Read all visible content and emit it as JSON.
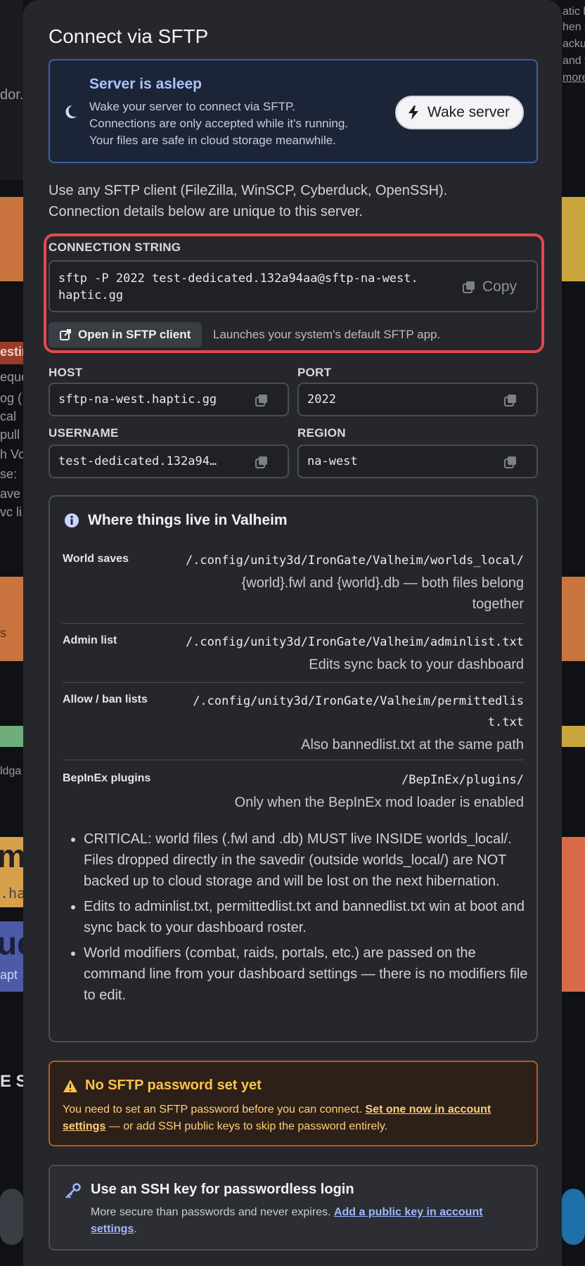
{
  "modal": {
    "title": "Connect via SFTP"
  },
  "asleep": {
    "heading": "Server is asleep",
    "lines": [
      "Wake your server to connect via SFTP.",
      "Connections are only accepted while it's running.",
      "Your files are safe in cloud storage meanwhile."
    ],
    "wake_label": "Wake server"
  },
  "intro": {
    "line1": "Use any SFTP client (FileZilla, WinSCP, Cyberduck, OpenSSH).",
    "line2": "Connection details below are unique to this server."
  },
  "connection": {
    "label": "CONNECTION STRING",
    "value": "sftp -P 2022 test-dedicated.132a94aa@sftp-na-west.haptic.gg",
    "copy_label": "Copy",
    "open_label": "Open in SFTP client",
    "open_note": "Launches your system's default SFTP app."
  },
  "fields": {
    "host": {
      "label": "HOST",
      "value": "sftp-na-west.haptic.gg"
    },
    "port": {
      "label": "PORT",
      "value": "2022"
    },
    "username": {
      "label": "USERNAME",
      "value": "test-dedicated.132a94…"
    },
    "region": {
      "label": "REGION",
      "value": "na-west"
    }
  },
  "where": {
    "heading": "Where things live in Valheim",
    "rows": [
      {
        "key": "World saves",
        "path": "/.config/unity3d/IronGate/Valheim/worlds_local/",
        "note_lines": [
          "{world}.fwl and {world}.db — both files belong",
          "together"
        ]
      },
      {
        "key": "Admin list",
        "path": "/.config/unity3d/IronGate/Valheim/adminlist.txt",
        "note_lines": [
          "Edits sync back to your dashboard"
        ]
      },
      {
        "key": "Allow / ban lists",
        "path_lines": [
          "/.config/unity3d/IronGate/Valheim/permittedlis",
          "t.txt"
        ],
        "note_lines": [
          "Also bannedlist.txt at the same path"
        ]
      },
      {
        "key": "BepInEx plugins",
        "path": "/BepInEx/plugins/",
        "note_lines": [
          "Only when the BepInEx mod loader is enabled"
        ]
      }
    ],
    "bullets": [
      "CRITICAL: world files (.fwl and .db) MUST live INSIDE worlds_local/. Files dropped directly in the savedir (outside worlds_local/) are NOT backed up to cloud storage and will be lost on the next hibernation.",
      "Edits to adminlist.txt, permittedlist.txt and bannedlist.txt win at boot and sync back to your dashboard roster.",
      "World modifiers (combat, raids, portals, etc.) are passed on the command line from your dashboard settings — there is no modifiers file to edit."
    ]
  },
  "warning": {
    "heading": "No SFTP password set yet",
    "text_before": "You need to set an SFTP password before you can connect. ",
    "link": "Set one now in account settings",
    "text_after": " — or add SSH public keys to skip the password entirely."
  },
  "ssh": {
    "heading": "Use an SSH key for passwordless login",
    "text_before": "More secure than passwords and never expires. ",
    "link": "Add a public key in account settings",
    "text_after": "."
  },
  "background": {
    "fragments": [
      "dor.",
      "estin",
      "eque",
      "og (",
      "cal",
      "pull",
      "h Vo",
      "se:",
      "ave y",
      "vc li",
      "s",
      "ldga",
      "m",
      ".ha",
      "ue",
      "apt",
      "E S",
      "atic l",
      "hen de",
      "acku",
      "and y",
      "more"
    ]
  },
  "colors": {
    "modal_bg": "#25272c",
    "asleep_border": "#3a5fa8",
    "highlight_border": "#e5484d",
    "warning_border": "#b85a1c",
    "warning_text": "#ffc24a",
    "link_blue": "#9fb8ff"
  },
  "icons": [
    "moon-icon",
    "bolt-icon",
    "copy-icon",
    "external-link-icon",
    "info-icon",
    "warning-icon",
    "key-icon"
  ]
}
